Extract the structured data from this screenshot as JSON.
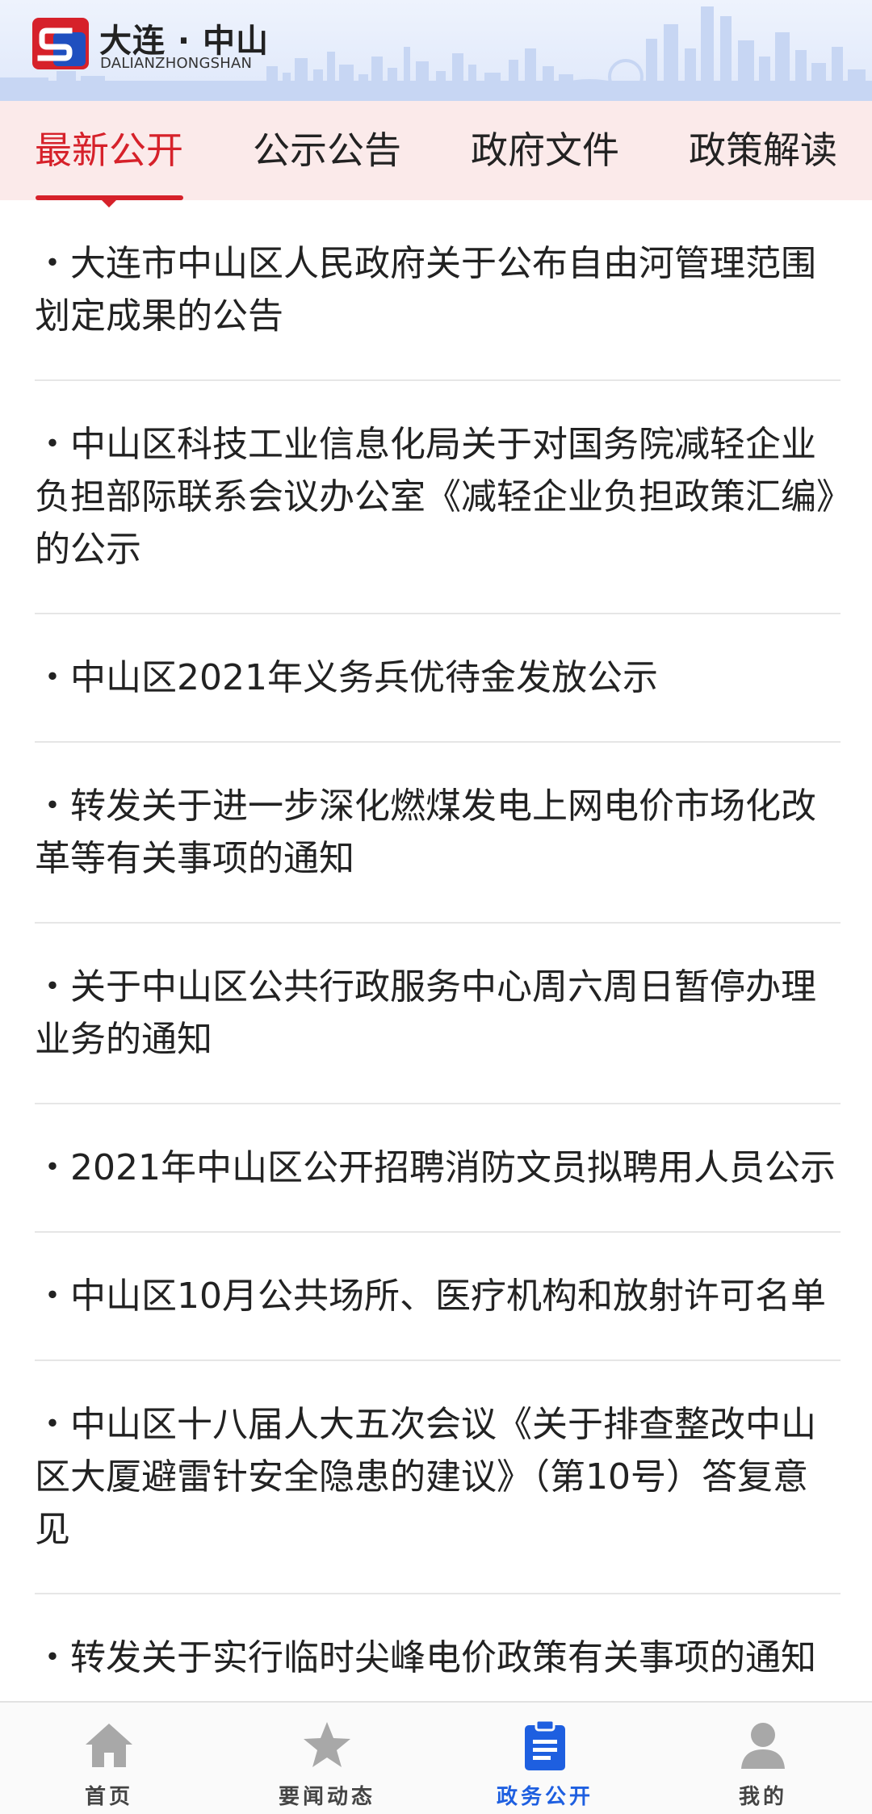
{
  "header": {
    "title": "大连 · 中山",
    "subtitle": "DALIANZHONGSHAN"
  },
  "tabs": [
    {
      "label": "最新公开",
      "active": true
    },
    {
      "label": "公示公告",
      "active": false
    },
    {
      "label": "政府文件",
      "active": false
    },
    {
      "label": "政策解读",
      "active": false
    }
  ],
  "list": {
    "items": [
      "・大连市中山区人民政府关于公布自由河管理范围划定成果的公告",
      "・中山区科技工业信息化局关于对国务院减轻企业负担部际联系会议办公室《减轻企业负担政策汇编》的公示",
      "・中山区2021年义务兵优待金发放公示",
      "・转发关于进一步深化燃煤发电上网电价市场化改革等有关事项的通知",
      "・关于中山区公共行政服务中心周六周日暂停办理业务的通知",
      "・2021年中山区公开招聘消防文员拟聘用人员公示",
      "・中山区10月公共场所、医疗机构和放射许可名单",
      "・中山区十八届人大五次会议《关于排查整改中山区大厦避雷针安全隐患的建议》（第10号）答复意见",
      "・转发关于实行临时尖峰电价政策有关事项的通知"
    ]
  },
  "bottom_nav": [
    {
      "label": "首页",
      "icon": "home-icon",
      "active": false
    },
    {
      "label": "要闻动态",
      "icon": "star-icon",
      "active": false
    },
    {
      "label": "政务公开",
      "icon": "clipboard-icon",
      "active": true
    },
    {
      "label": "我的",
      "icon": "user-icon",
      "active": false
    }
  ],
  "colors": {
    "accent_red": "#d6212a",
    "accent_blue": "#1e5fe0",
    "tab_bg": "#fbeaea",
    "header_bg": "#dfe8fa"
  }
}
